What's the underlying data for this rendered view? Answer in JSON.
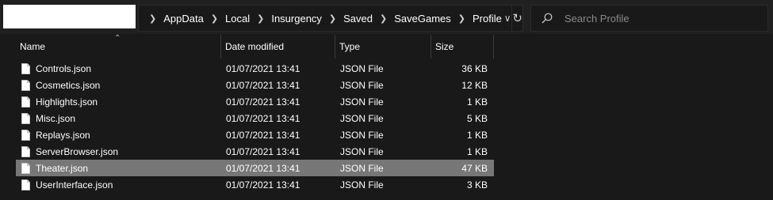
{
  "breadcrumb": [
    "AppData",
    "Local",
    "Insurgency",
    "Saved",
    "SaveGames",
    "Profile"
  ],
  "search": {
    "placeholder": "Search Profile"
  },
  "columns": {
    "name": "Name",
    "date": "Date modified",
    "type": "Type",
    "size": "Size"
  },
  "files": [
    {
      "name": "Controls.json",
      "date": "01/07/2021 13:41",
      "type": "JSON File",
      "size": "36 KB"
    },
    {
      "name": "Cosmetics.json",
      "date": "01/07/2021 13:41",
      "type": "JSON File",
      "size": "12 KB"
    },
    {
      "name": "Highlights.json",
      "date": "01/07/2021 13:41",
      "type": "JSON File",
      "size": "1 KB"
    },
    {
      "name": "Misc.json",
      "date": "01/07/2021 13:41",
      "type": "JSON File",
      "size": "5 KB"
    },
    {
      "name": "Replays.json",
      "date": "01/07/2021 13:41",
      "type": "JSON File",
      "size": "1 KB"
    },
    {
      "name": "ServerBrowser.json",
      "date": "01/07/2021 13:41",
      "type": "JSON File",
      "size": "1 KB"
    },
    {
      "name": "Theater.json",
      "date": "01/07/2021 13:41",
      "type": "JSON File",
      "size": "47 KB"
    },
    {
      "name": "UserInterface.json",
      "date": "01/07/2021 13:41",
      "type": "JSON File",
      "size": "3 KB"
    }
  ],
  "selected_file": "Theater.json",
  "icons": {
    "breadcrumb_separator": "chevron-right-icon",
    "history": "chevron-down-icon",
    "refresh": "refresh-icon",
    "search": "search-icon",
    "file": "file-icon",
    "sort": "sort-up-icon"
  },
  "colors": {
    "background": "#191919",
    "selected_row": "#777777",
    "text": "#ffffff"
  }
}
